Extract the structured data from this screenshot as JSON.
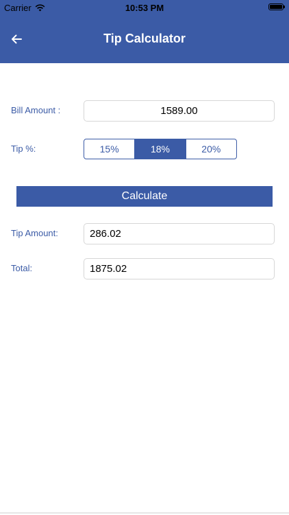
{
  "status_bar": {
    "carrier": "Carrier",
    "time": "10:53 PM"
  },
  "header": {
    "title": "Tip Calculator",
    "background": "#3b5ba6"
  },
  "bill": {
    "label": "Bill Amount :",
    "value": "1589.00"
  },
  "tip": {
    "label": "Tip %:",
    "options": [
      "15%",
      "18%",
      "20%"
    ],
    "selected": "18%"
  },
  "calculate": {
    "label": "Calculate"
  },
  "tip_amount": {
    "label": "Tip Amount:",
    "value": "286.02"
  },
  "total": {
    "label": "Total:",
    "value": "1875.02"
  },
  "colors": {
    "accent": "#3b5ba6",
    "label_text": "#3b5ba6",
    "field_border": "#d6d6d6"
  }
}
